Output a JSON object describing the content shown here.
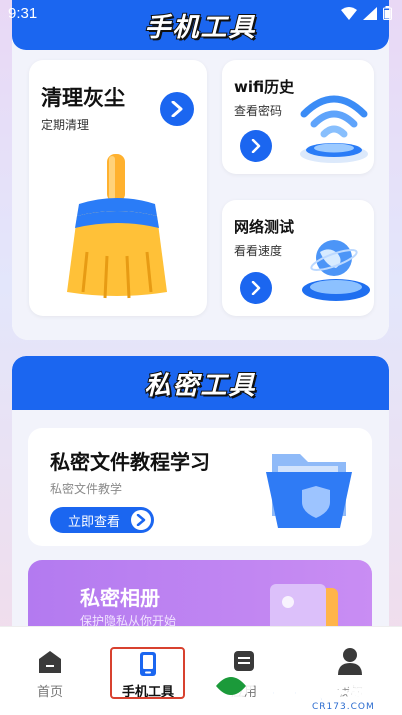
{
  "status_bar": {
    "time": "9:31"
  },
  "section_phone_tools": {
    "title": "手机工具",
    "clean_card": {
      "title": "清理灰尘",
      "subtitle": "定期清理"
    },
    "wifi_card": {
      "title": "wifi历史",
      "subtitle": "查看密码"
    },
    "network_card": {
      "title": "网络测试",
      "subtitle": "看看速度"
    }
  },
  "section_private_tools": {
    "title": "私密工具",
    "file_card": {
      "title": "私密文件教程学习",
      "subtitle": "私密文件教学",
      "button_label": "立即查看"
    },
    "album_card": {
      "title": "私密相册",
      "subtitle": "保护隐私从你开始"
    }
  },
  "bottom_nav": {
    "items": [
      {
        "label": "首页",
        "icon": "home-icon"
      },
      {
        "label": "手机工具",
        "icon": "phone-icon"
      },
      {
        "label": "应用",
        "icon": "app-icon"
      },
      {
        "label": "我的",
        "icon": "user-icon"
      }
    ]
  },
  "watermark": {
    "text": "西西软件园",
    "sub": "CR173.COM"
  },
  "colors": {
    "primary": "#1b66f0",
    "active_highlight": "#d8412f",
    "album_purple": "#b37af0"
  }
}
